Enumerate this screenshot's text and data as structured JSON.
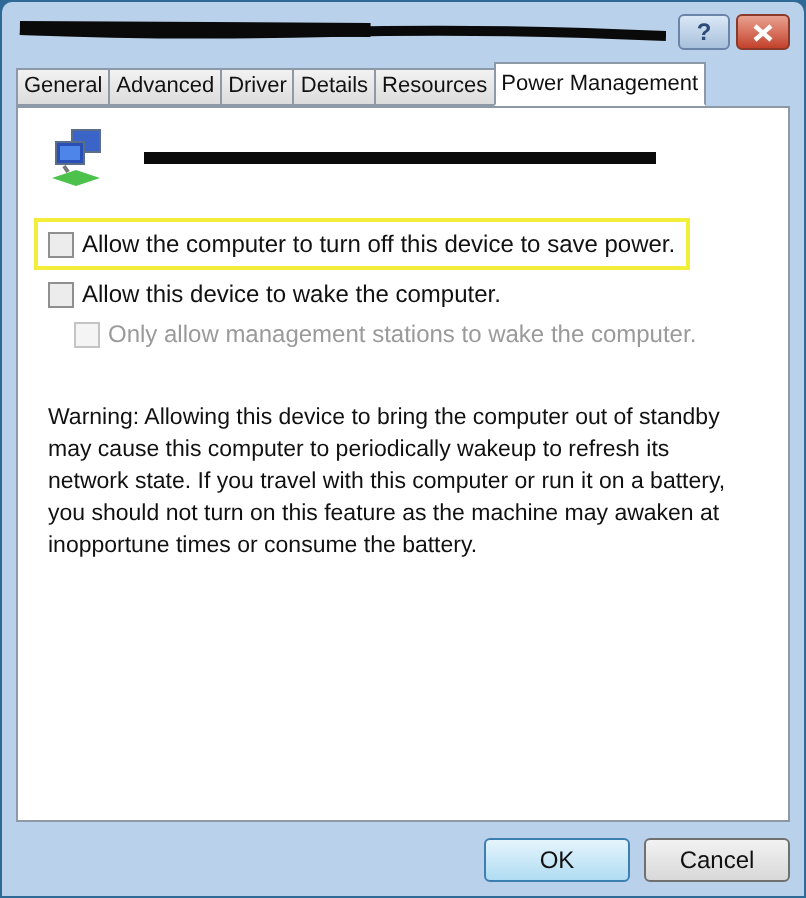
{
  "window": {
    "help_button": "?"
  },
  "tabs": [
    {
      "label": "General",
      "selected": false
    },
    {
      "label": "Advanced",
      "selected": false
    },
    {
      "label": "Driver",
      "selected": false
    },
    {
      "label": "Details",
      "selected": false
    },
    {
      "label": "Resources",
      "selected": false
    },
    {
      "label": "Power Management",
      "selected": true
    }
  ],
  "options": [
    {
      "label": "Allow the computer to turn off this device to save power.",
      "checked": false,
      "disabled": false,
      "highlighted": true
    },
    {
      "label": "Allow this device to wake the computer.",
      "checked": false,
      "disabled": false,
      "highlighted": false,
      "children": [
        {
          "label": "Only allow management stations to wake the computer.",
          "checked": false,
          "disabled": true
        }
      ]
    }
  ],
  "warning": "Warning: Allowing this device to bring the computer out of standby may cause this computer to periodically wakeup to refresh its network state. If you travel with this computer or run it on a battery, you should not turn on this feature as the machine may awaken at inopportune times or consume the battery.",
  "buttons": [
    {
      "label": "OK",
      "default": true
    },
    {
      "label": "Cancel",
      "default": false
    }
  ]
}
